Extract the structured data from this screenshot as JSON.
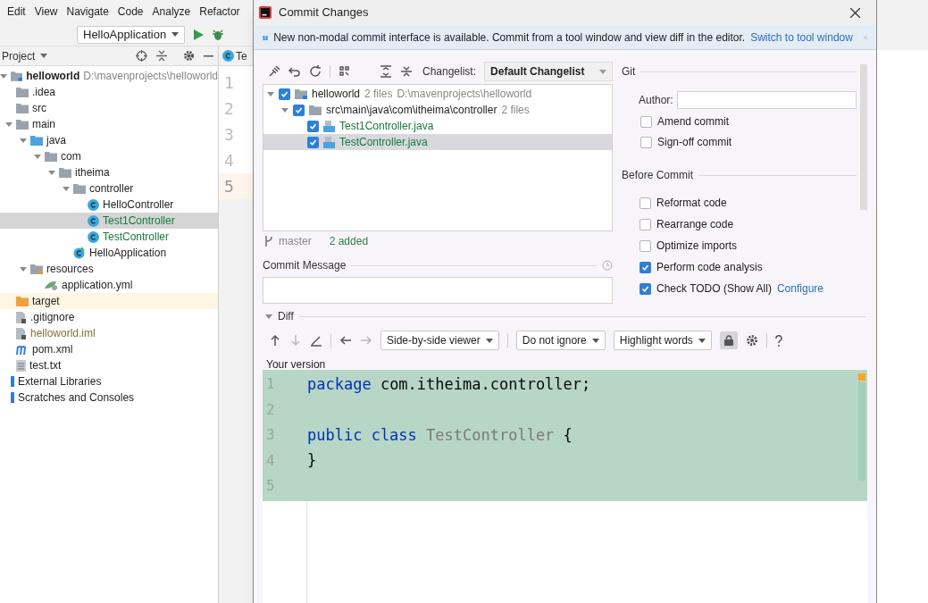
{
  "menu_bar": [
    "Edit",
    "View",
    "Navigate",
    "Code",
    "Analyze",
    "Refactor"
  ],
  "toolbar": {
    "run_config": "HelloApplication"
  },
  "project_panel": {
    "title": "Project",
    "tree": [
      {
        "label": "helloworld",
        "kind": "module",
        "detail": "D:\\mavenprojects\\helloworld",
        "expanded": true,
        "selected": false,
        "children": [
          {
            "label": ".idea",
            "kind": "folder",
            "selected": false
          },
          {
            "label": "src",
            "kind": "folder",
            "selected": false
          },
          {
            "label": "main",
            "kind": "folder",
            "expanded": true,
            "selected": false,
            "children": [
              {
                "label": "java",
                "kind": "source-folder",
                "expanded": true,
                "selected": false,
                "children": [
                  {
                    "label": "com",
                    "kind": "package",
                    "expanded": true,
                    "selected": false,
                    "children": [
                      {
                        "label": "itheima",
                        "kind": "package",
                        "expanded": true,
                        "selected": false,
                        "children": [
                          {
                            "label": "controller",
                            "kind": "package",
                            "expanded": true,
                            "selected": false,
                            "children": [
                              {
                                "label": "HelloController",
                                "kind": "class",
                                "selected": false
                              },
                              {
                                "label": "Test1Controller",
                                "kind": "class",
                                "added": true,
                                "selected": true
                              },
                              {
                                "label": "TestController",
                                "kind": "class",
                                "added": true,
                                "selected": false
                              }
                            ]
                          },
                          {
                            "label": "HelloApplication",
                            "kind": "app",
                            "selected": false
                          }
                        ]
                      }
                    ]
                  }
                ]
              },
              {
                "label": "resources",
                "kind": "resources",
                "expanded": true,
                "selected": false,
                "children": [
                  {
                    "label": "application.yml",
                    "kind": "yml",
                    "selected": false
                  }
                ]
              }
            ]
          },
          {
            "label": "target",
            "kind": "excluded-folder",
            "selected": false
          },
          {
            "label": ".gitignore",
            "kind": "file",
            "selected": false
          },
          {
            "label": "helloworld.iml",
            "kind": "file",
            "ignored": true,
            "selected": false
          },
          {
            "label": "pom.xml",
            "kind": "maven",
            "selected": false
          },
          {
            "label": "test.txt",
            "kind": "text",
            "selected": false
          }
        ]
      },
      {
        "label": "External Libraries",
        "kind": "library",
        "selected": false
      },
      {
        "label": "Scratches and Consoles",
        "kind": "scratch",
        "selected": false
      }
    ]
  },
  "editor": {
    "tab": "Te",
    "line_numbers": [
      {
        "number": "1",
        "current": false
      },
      {
        "number": "2",
        "current": false
      },
      {
        "number": "3",
        "current": false
      },
      {
        "number": "4",
        "current": false
      },
      {
        "number": "5",
        "current": true
      }
    ]
  },
  "dialog": {
    "title": "Commit Changes",
    "banner": {
      "text": "New non-modal commit interface is available. Commit from a tool window and view diff in the editor.",
      "link": "Switch to tool window"
    },
    "changelist_label": "Changelist:",
    "changelist": "Default Changelist",
    "changes": [
      {
        "label": "helloworld",
        "detail": "2 files",
        "path": "D:\\mavenprojects\\helloworld",
        "kind": "module",
        "checked": true,
        "expanded": true,
        "selected": false,
        "children": [
          {
            "label": "src\\main\\java\\com\\itheima\\controller",
            "detail": "2 files",
            "kind": "folder",
            "checked": true,
            "expanded": true,
            "selected": false,
            "children": [
              {
                "label": "Test1Controller.java",
                "kind": "java",
                "checked": true,
                "selected": false
              },
              {
                "label": "TestController.java",
                "kind": "java",
                "checked": true,
                "selected": true
              }
            ]
          }
        ]
      }
    ],
    "branch": "master",
    "summary": "2 added",
    "commit_message": {
      "label": "Commit Message"
    },
    "git": {
      "title": "Git",
      "author_label": "Author:",
      "options": [
        {
          "label": "Amend commit",
          "checked": false
        },
        {
          "label": "Sign-off commit",
          "checked": false
        }
      ]
    },
    "before_commit": {
      "title": "Before Commit",
      "options": [
        {
          "label": "Reformat code",
          "checked": false
        },
        {
          "label": "Rearrange code",
          "checked": false
        },
        {
          "label": "Optimize imports",
          "checked": false
        },
        {
          "label": "Perform code analysis",
          "checked": true
        },
        {
          "label": "Check TODO (Show All)",
          "checked": true,
          "link": "Configure"
        }
      ]
    },
    "diff": {
      "title": "Diff",
      "expanded": true,
      "viewer": "Side-by-side viewer",
      "ignore": "Do not ignore",
      "highlight": "Highlight words",
      "locked": true,
      "caption": "Your version",
      "lines": [
        {
          "number": "1",
          "tokens": [
            {
              "kind": "keyword",
              "text": "package"
            },
            {
              "kind": "plain",
              "text": " com.itheima.controller;"
            }
          ]
        },
        {
          "number": "2"
        },
        {
          "number": "3",
          "tokens": [
            {
              "kind": "keyword",
              "text": "public class"
            },
            {
              "kind": "unused",
              "text": " TestController"
            },
            {
              "kind": "plain",
              "text": " {"
            }
          ]
        },
        {
          "number": "4",
          "tokens": [
            {
              "kind": "plain",
              "text": "}"
            }
          ]
        },
        {
          "number": "5"
        }
      ]
    }
  }
}
